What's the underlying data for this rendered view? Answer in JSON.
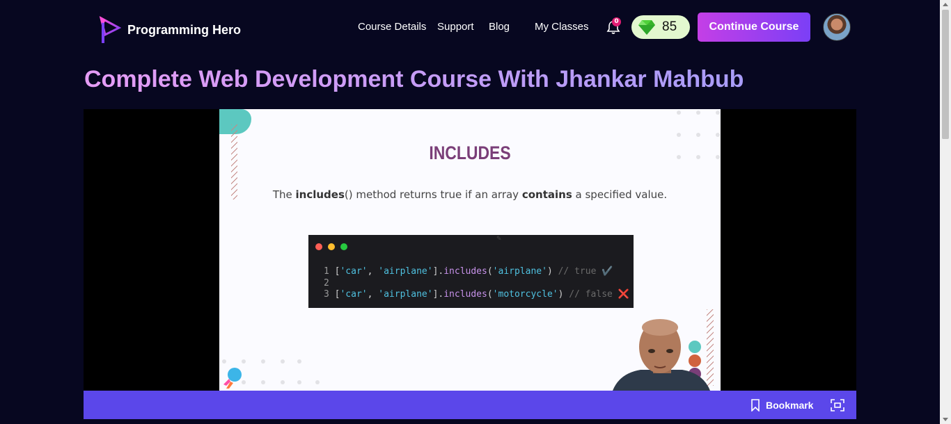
{
  "header": {
    "logo_text": "Programming Hero",
    "nav": [
      "Course Details",
      "Support",
      "Blog",
      "My Classes"
    ],
    "notification_count": "0",
    "gems": "85",
    "continue_label": "Continue Course"
  },
  "course": {
    "title": "Complete Web Development Course With Jhankar Mahbub"
  },
  "slide": {
    "title": "INCLUDES",
    "desc_1": "The ",
    "desc_2": "includes",
    "desc_3": "() method returns true if an array ",
    "desc_4": "contains",
    "desc_5": " a specified value.",
    "code": {
      "line1_no": "1",
      "line1_open": " [",
      "line1_s1": "'car'",
      "line1_comma": ", ",
      "line1_s2": "'airplane'",
      "line1_close": "].",
      "line1_fn": "includes",
      "line1_paren_open": "(",
      "line1_arg": "'airplane'",
      "line1_paren_close": ") ",
      "line1_comment": "// true",
      "line1_emoji": " ✔️",
      "line2_no": "2",
      "line3_no": "3",
      "line3_open": " [",
      "line3_s1": "'car'",
      "line3_comma": ", ",
      "line3_s2": "'airplane'",
      "line3_close": "].",
      "line3_fn": "includes",
      "line3_paren_open": "(",
      "line3_arg": "'motorcycle'",
      "line3_paren_close": ") ",
      "line3_comment": "// false",
      "line3_emoji": " ❌"
    }
  },
  "controls": {
    "bookmark_label": "Bookmark"
  },
  "icons": {
    "bell": "bell-icon",
    "gem": "gem-icon",
    "bookmark": "bookmark-icon",
    "fullscreen": "fullscreen-icon"
  },
  "colors": {
    "background": "#070720",
    "accent_purple": "#5b47ea",
    "continue_gradient_start": "#c43fe6",
    "continue_gradient_end": "#7b3ff6",
    "gem_pill": "#e3f8cf",
    "slide_title": "#7a3e78"
  }
}
